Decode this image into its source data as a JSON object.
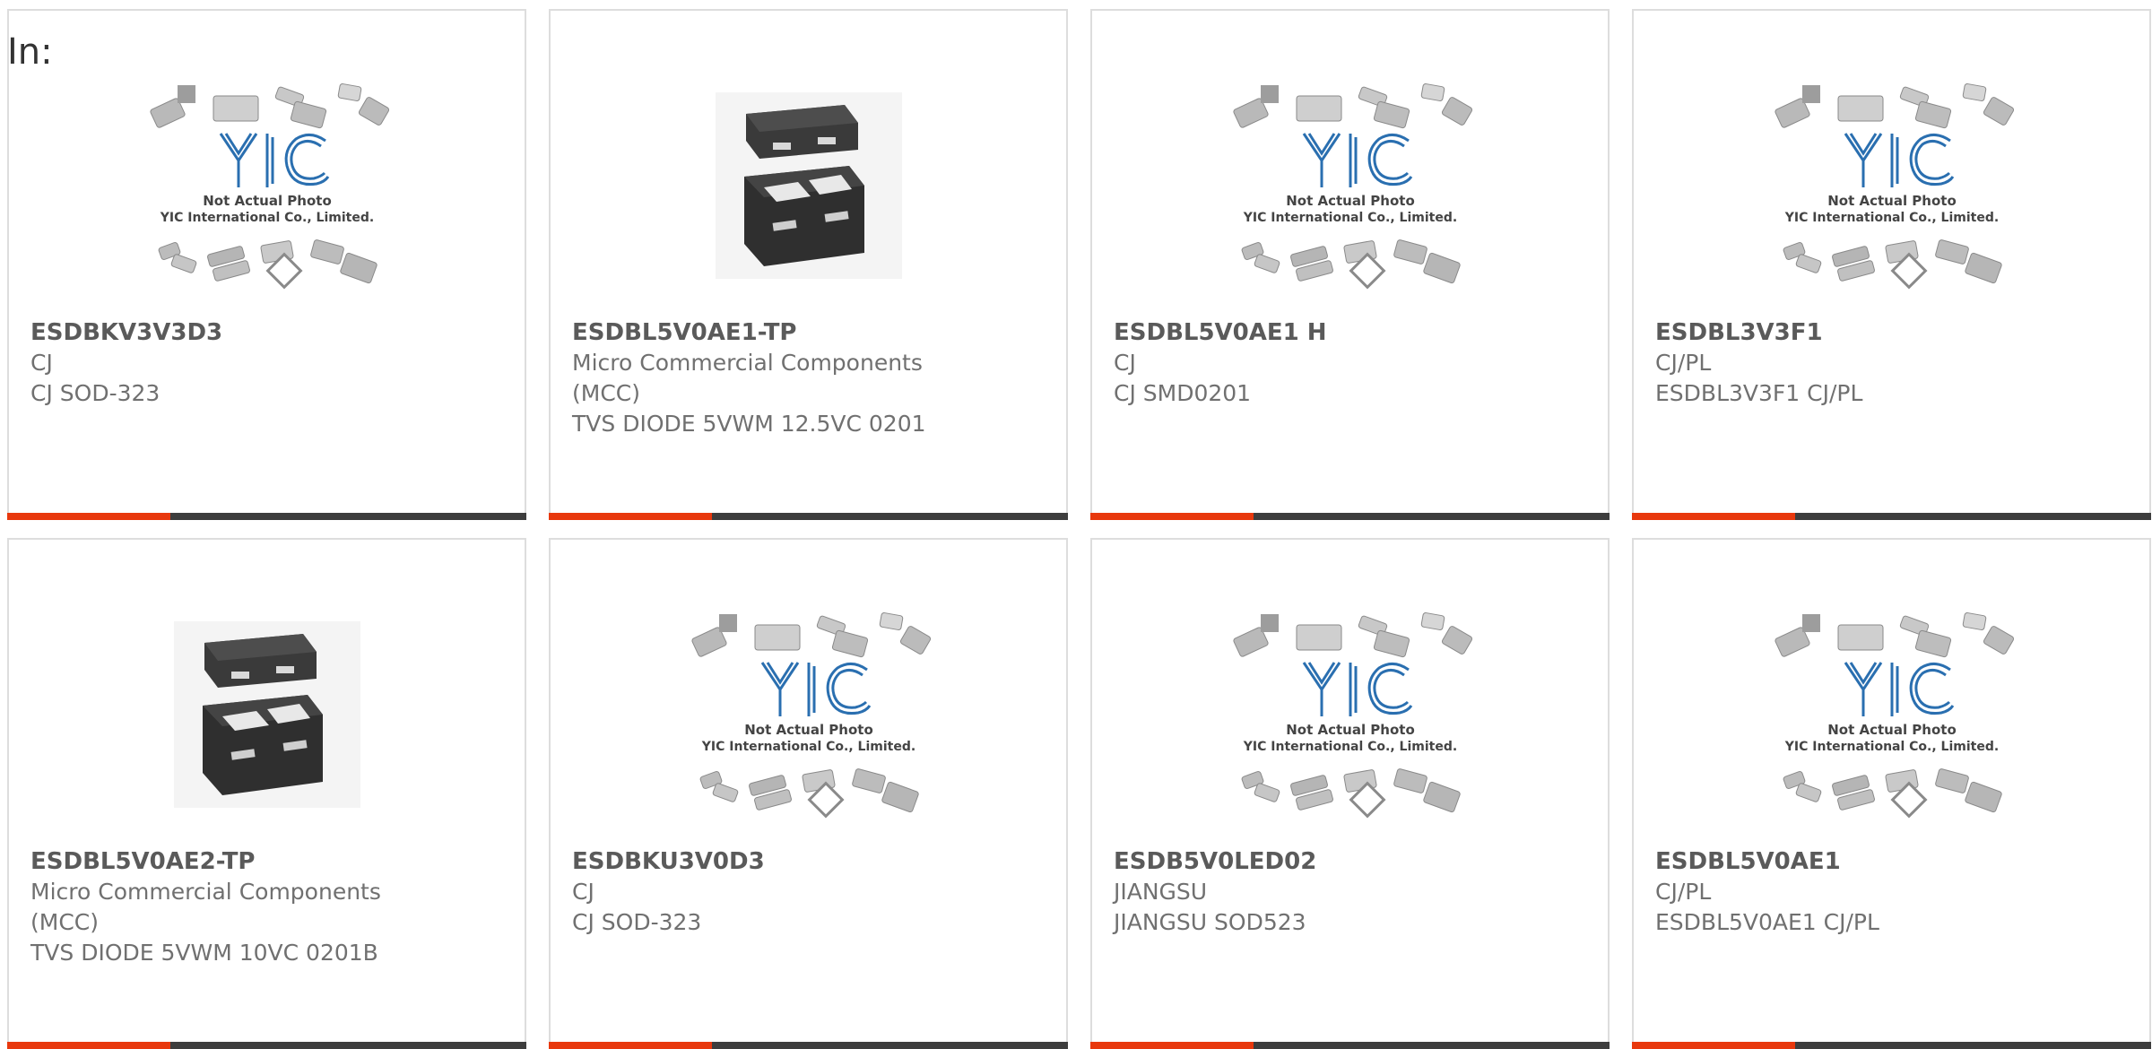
{
  "filter_label": "In:",
  "placeholder": {
    "line1": "Not Actual Photo",
    "line2": "YIC International Co., Limited."
  },
  "colors": {
    "accent": "#e8380d",
    "bar": "#3d3d3d",
    "logo_blue": "#2a6fb0"
  },
  "products": [
    {
      "part": "ESDBKV3V3D3",
      "manufacturer": "CJ",
      "description": "CJ SOD-323",
      "image": "placeholder"
    },
    {
      "part": "ESDBL5V0AE1-TP",
      "manufacturer": "Micro Commercial Components (MCC)",
      "description": "TVS DIODE 5VWM 12.5VC 0201",
      "image": "package-photo"
    },
    {
      "part": "ESDBL5V0AE1 H",
      "manufacturer": "CJ",
      "description": "CJ SMD0201",
      "image": "placeholder"
    },
    {
      "part": "ESDBL3V3F1",
      "manufacturer": "CJ/PL",
      "description": "ESDBL3V3F1 CJ/PL",
      "image": "placeholder"
    },
    {
      "part": "ESDBL5V0AE2-TP",
      "manufacturer": "Micro Commercial Components (MCC)",
      "description": "TVS DIODE 5VWM 10VC 0201B",
      "image": "package-photo"
    },
    {
      "part": "ESDBKU3V0D3",
      "manufacturer": "CJ",
      "description": "CJ SOD-323",
      "image": "placeholder"
    },
    {
      "part": "ESDB5V0LED02",
      "manufacturer": "JIANGSU",
      "description": "JIANGSU SOD523",
      "image": "placeholder"
    },
    {
      "part": "ESDBL5V0AE1",
      "manufacturer": "CJ/PL",
      "description": "ESDBL5V0AE1 CJ/PL",
      "image": "placeholder"
    }
  ]
}
